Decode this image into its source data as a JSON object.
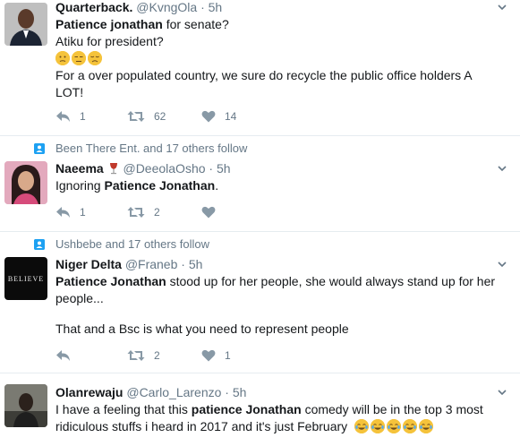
{
  "tweets": [
    {
      "name": "Quarterback.",
      "handle": "@KvngOla",
      "dot": "·",
      "time": "5h",
      "line1_bold": "Patience jonathan",
      "line1_rest": " for senate?",
      "line2": "Atiku for president?",
      "line3": "For a over populated country, we sure do recycle the public office holders A",
      "line4": "LOT!",
      "replies": "1",
      "retweets": "62",
      "likes": "14"
    },
    {
      "social": "Been There Ent. and 17 others follow",
      "name": "Naeema",
      "handle": "@DeeolaOsho",
      "dot": "·",
      "time": "5h",
      "text_pre": "Ignoring ",
      "text_bold": "Patience Jonathan",
      "text_post": ".",
      "replies": "1",
      "retweets": "2",
      "likes": ""
    },
    {
      "social": "Ushbebe and 17 others follow",
      "name": "Niger Delta",
      "handle": "@Franeb",
      "dot": "·",
      "time": "5h",
      "avatar_text": "BELIEVE",
      "text_bold": "Patience Jonathan",
      "text_rest1": " stood up for her people, she would always stand up for her",
      "text_rest2": "people...",
      "text_para2": "That and a Bsc is what you need to represent people",
      "replies": "",
      "retweets": "2",
      "likes": "1"
    },
    {
      "name": "Olanrewaju",
      "handle": "@Carlo_Larenzo",
      "dot": "·",
      "time": "5h",
      "text_pre": "I have a feeling that this ",
      "text_bold": "patience Jonathan",
      "text_rest1": " comedy will be in the top 3 most",
      "text_rest2": "ridiculous stuffs i heard in 2017 and it's just February"
    }
  ],
  "icons": {
    "reply": "reply-icon",
    "retweet": "retweet-icon",
    "like": "heart-icon",
    "caret": "chevron-down-icon",
    "follow": "person-follow-icon"
  },
  "colors": {
    "icon": "#8899a6",
    "accent": "#1da1f2",
    "text": "#14171a",
    "muted": "#657786",
    "divider": "#e6ecf0"
  }
}
